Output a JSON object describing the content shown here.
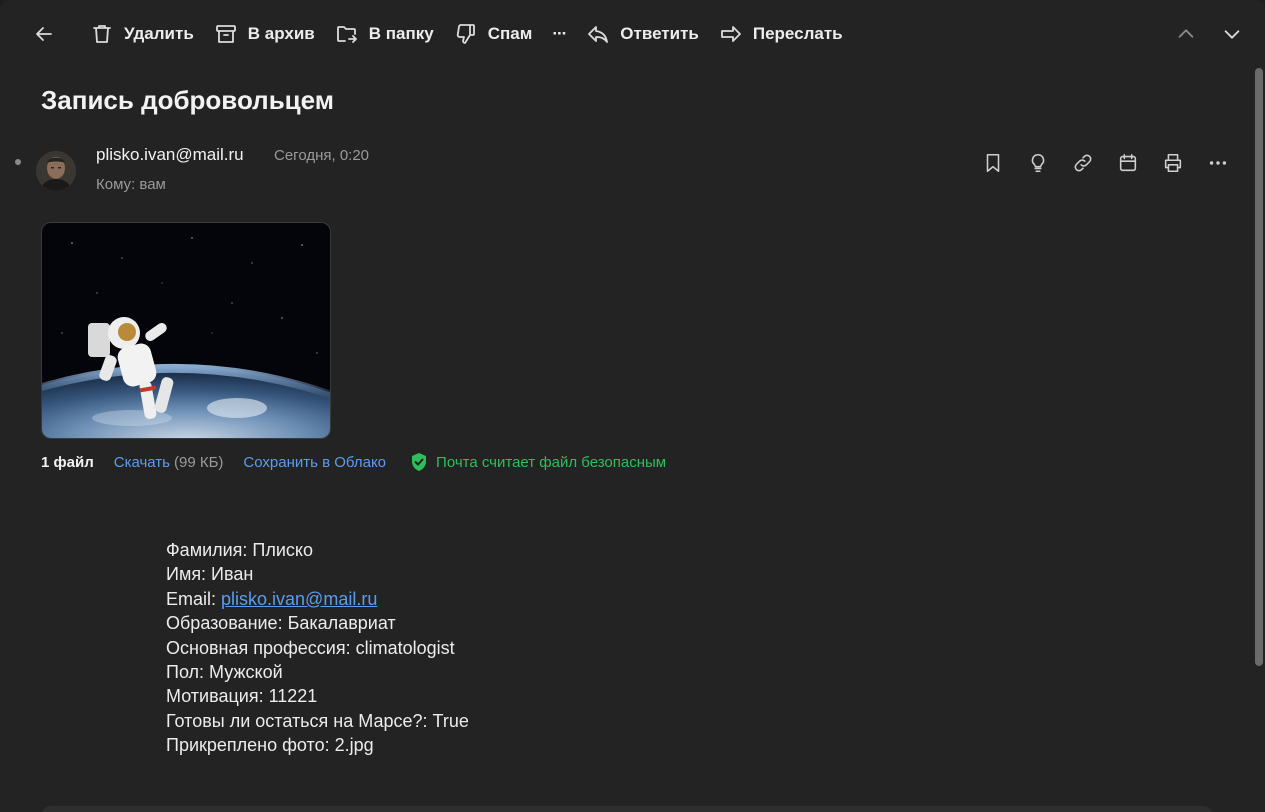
{
  "toolbar": {
    "delete_label": "Удалить",
    "archive_label": "В архив",
    "move_label": "В папку",
    "spam_label": "Спам",
    "more_label": "···",
    "reply_label": "Ответить",
    "forward_label": "Переслать"
  },
  "message": {
    "subject": "Запись добровольцем",
    "sender": "plisko.ivan@mail.ru",
    "date": "Сегодня, 0:20",
    "to": "Кому: вам",
    "actions": [
      "bookmark-icon",
      "lightbulb-icon",
      "link-icon",
      "calendar-icon",
      "print-icon",
      "more-icon"
    ]
  },
  "attachments": {
    "count_label": "1 файл",
    "download_label": "Скачать",
    "size": "(99 КБ)",
    "save_cloud_label": "Сохранить в Облако",
    "safe_label": "Почта считает файл безопасным"
  },
  "body": {
    "surname": "Фамилия: Плиско",
    "name": "Имя: Иван",
    "email_prefix": "Email: ",
    "email": "plisko.ivan@mail.ru",
    "education": "Образование: Бакалавриат",
    "profession": "Основная профессия: climatologist",
    "gender": "Пол: Мужской",
    "motivation": "Мотивация: 11221",
    "mars": "Готовы ли остаться на Марсе?: True",
    "photo": "Прикреплено фото: 2.jpg"
  },
  "colors": {
    "background": "#232323",
    "link": "#5b9cf0",
    "safe": "#2dbf5c",
    "muted": "#9a9a9a"
  }
}
